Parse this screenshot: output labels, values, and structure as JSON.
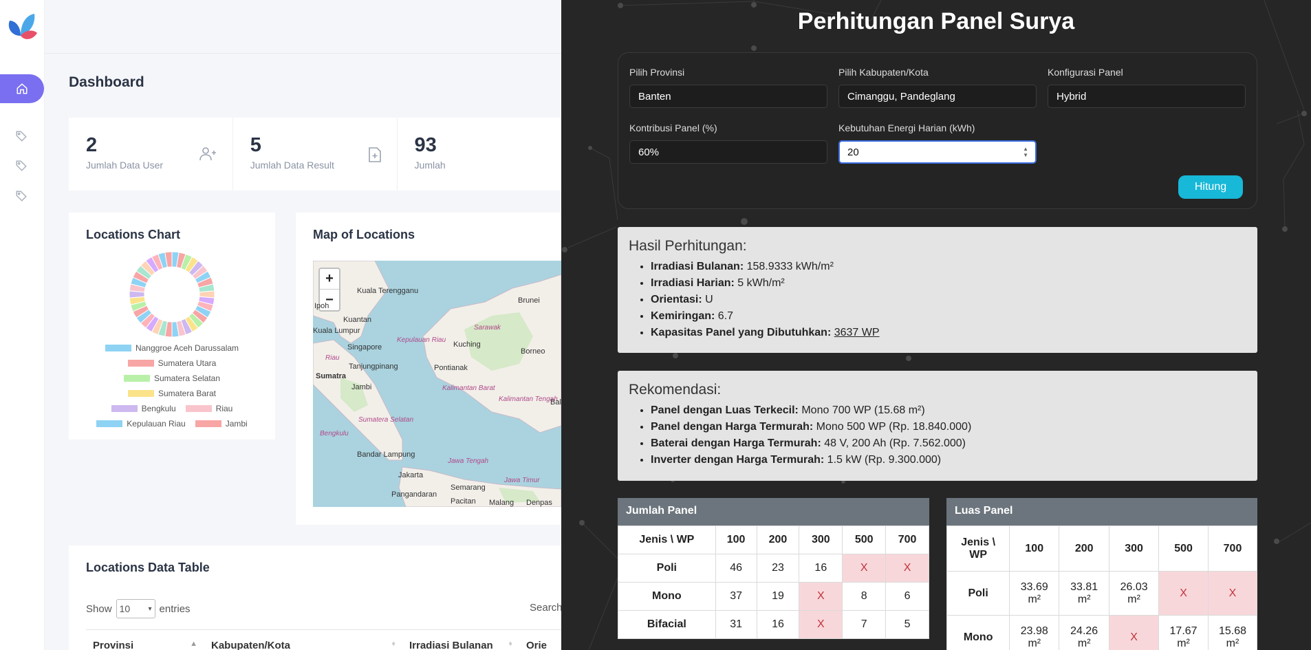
{
  "sidebar": {
    "items": [
      {
        "name": "home",
        "icon": "home-icon",
        "active": true
      },
      {
        "name": "tag-1",
        "icon": "tag-icon"
      },
      {
        "name": "tag-2",
        "icon": "tag-icon"
      },
      {
        "name": "tag-3",
        "icon": "tag-icon"
      }
    ]
  },
  "dashboard": {
    "title": "Dashboard",
    "stats": [
      {
        "value": "2",
        "label": "Jumlah Data User",
        "icon": "user-plus-icon"
      },
      {
        "value": "5",
        "label": "Jumlah Data Result",
        "icon": "file-plus-icon"
      },
      {
        "value": "93",
        "label": "Jumlah",
        "icon": ""
      }
    ],
    "locations_chart": {
      "title": "Locations Chart",
      "legend": [
        {
          "label": "Nanggroe Aceh Darussalam",
          "color": "#8fd3f4"
        },
        {
          "label": "Sumatera Utara",
          "color": "#f8a5a5"
        },
        {
          "label": "Sumatera Selatan",
          "color": "#b8f0a8"
        },
        {
          "label": "Sumatera Barat",
          "color": "#fbe38a"
        },
        {
          "label": "Bengkulu",
          "color": "#cdb8f0"
        },
        {
          "label": "Riau",
          "color": "#f9c4cc"
        },
        {
          "label": "Kepulauan Riau",
          "color": "#8fd3f4"
        },
        {
          "label": "Jambi",
          "color": "#f8a5a5"
        }
      ]
    },
    "map": {
      "title": "Map of Locations",
      "zoom_in": "+",
      "zoom_out": "−",
      "labels": {
        "kuala_terengganu": "Kuala Terengganu",
        "brunei": "Brunei",
        "ipoh": "Ipoh",
        "kuantan": "Kuantan",
        "kuala_lumpur": "Kuala Lumpur",
        "sarawak": "Sarawak",
        "kepulauan": "Kepulauan Riau",
        "kuching": "Kuching",
        "borneo": "Borneo",
        "singapore": "Singapore",
        "riau": "Riau",
        "tanjungpinang": "Tanjungpinang",
        "pontianak": "Pontianak",
        "sumatra": "Sumatra",
        "jambi": "Jambi",
        "kalbar": "Kalimantan Barat",
        "kalteng": "Kalimantan Tengah",
        "bali": "Bali",
        "sumsel": "Sumatera Selatan",
        "bengkulu": "Bengkulu",
        "bandar_lampung": "Bandar Lampung",
        "jawa_tengah": "Jawa Tengah",
        "jakarta": "Jakarta",
        "jawa_timur": "Jawa Timur",
        "pangandaran": "Pangandaran",
        "semarang": "Semarang",
        "pacitan": "Pacitan",
        "malang": "Malang",
        "denpasar": "Denpas"
      }
    },
    "table": {
      "title": "Locations Data Table",
      "show_label": "Show",
      "entries_value": "10",
      "entries_label": "entries",
      "search_label": "Search",
      "columns": [
        "Provinsi",
        "Kabupaten/Kota",
        "Irradiasi Bulanan",
        "Orie"
      ]
    }
  },
  "calculator": {
    "title": "Perhitungan Panel Surya",
    "fields": {
      "provinsi_label": "Pilih Provinsi",
      "provinsi_value": "Banten",
      "kabupaten_label": "Pilih Kabupaten/Kota",
      "kabupaten_value": "Cimanggu, Pandeglang",
      "konfigurasi_label": "Konfigurasi Panel",
      "konfigurasi_value": "Hybrid",
      "kontribusi_label": "Kontribusi Panel (%)",
      "kontribusi_value": "60%",
      "kebutuhan_label": "Kebutuhan Energi Harian (kWh)",
      "kebutuhan_value": "20"
    },
    "button_label": "Hitung",
    "hasil": {
      "title": "Hasil Perhitungan:",
      "items": [
        {
          "label": "Irradiasi Bulanan:",
          "value": "158.9333 kWh/m²"
        },
        {
          "label": "Irradiasi Harian:",
          "value": "5 kWh/m²"
        },
        {
          "label": "Orientasi:",
          "value": "U"
        },
        {
          "label": "Kemiringan:",
          "value": "6.7"
        },
        {
          "label": "Kapasitas Panel yang Dibutuhkan:",
          "value": "3637 WP"
        }
      ]
    },
    "rekomendasi": {
      "title": "Rekomendasi:",
      "items": [
        {
          "label": "Panel dengan Luas Terkecil:",
          "value": "Mono 700 WP (15.68 m²)"
        },
        {
          "label": "Panel dengan Harga Termurah:",
          "value": "Mono 500 WP (Rp. 18.840.000)"
        },
        {
          "label": "Baterai dengan Harga Termurah:",
          "value": "48 V, 200 Ah (Rp. 7.562.000)"
        },
        {
          "label": "Inverter dengan Harga Termurah:",
          "value": "1.5 kW (Rp. 9.300.000)"
        }
      ]
    },
    "jumlah_panel": {
      "title": "Jumlah Panel",
      "corner": "Jenis \\ WP",
      "columns": [
        "100",
        "200",
        "300",
        "500",
        "700"
      ],
      "rows": [
        {
          "jenis": "Poli",
          "values": [
            "46",
            "23",
            "16",
            "X",
            "X"
          ]
        },
        {
          "jenis": "Mono",
          "values": [
            "37",
            "19",
            "X",
            "8",
            "6"
          ]
        },
        {
          "jenis": "Bifacial",
          "values": [
            "31",
            "16",
            "X",
            "7",
            "5"
          ]
        }
      ]
    },
    "luas_panel": {
      "title": "Luas Panel",
      "corner": "Jenis \\ WP",
      "columns": [
        "100",
        "200",
        "300",
        "500",
        "700"
      ],
      "rows": [
        {
          "jenis": "Poli",
          "values": [
            "33.69 m²",
            "33.81 m²",
            "26.03 m²",
            "X",
            "X"
          ]
        },
        {
          "jenis": "Mono",
          "values": [
            "23.98 m²",
            "24.26 m²",
            "X",
            "17.67 m²",
            "15.68 m²"
          ]
        }
      ]
    }
  }
}
